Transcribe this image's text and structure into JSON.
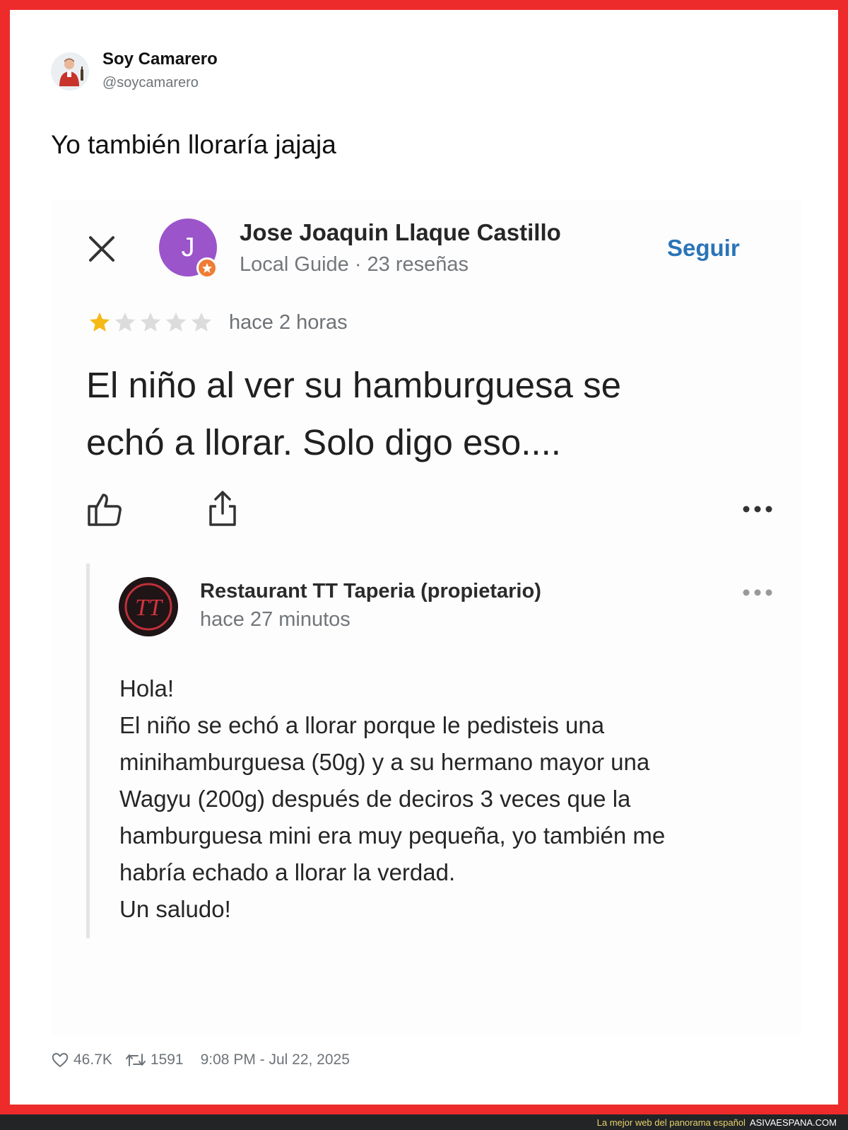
{
  "tweet": {
    "author_name": "Soy Camarero",
    "author_handle": "@soycamarero",
    "text": "Yo también lloraría jajaja",
    "likes": "46.7K",
    "retweets": "1591",
    "timestamp": "9:08 PM - Jul 22, 2025"
  },
  "review": {
    "avatar_letter": "J",
    "reviewer_name": "Jose Joaquin Llaque Castillo",
    "reviewer_meta": "Local Guide · 23 reseñas",
    "follow_label": "Seguir",
    "rating": 1,
    "rating_max": 5,
    "time": "hace 2 horas",
    "text_lines": [
      "El niño al ver su hamburguesa se",
      "echó a llorar. Solo digo eso...."
    ]
  },
  "reply": {
    "logo_text": "TT",
    "owner_name": "Restaurant TT Taperia (propietario)",
    "time": "hace 27 minutos",
    "lines": [
      "Hola!",
      "El niño se echó a llorar porque le pedisteis una",
      "minihamburguesa (50g) y a su hermano mayor una",
      "Wagyu (200g) después de deciros 3 veces que la",
      "hamburguesa mini era muy pequeña, yo también me",
      "habría echado a llorar la verdad.",
      "Un saludo!"
    ]
  },
  "footer": {
    "tagline": "La mejor web del panorama español",
    "site": "ASIVAESPANA.COM"
  },
  "colors": {
    "frame": "#ee2b2b",
    "follow": "#2a74b8",
    "reviewer_avatar": "#9b54c9",
    "star_filled": "#f5b916",
    "star_empty": "#dcdcdc"
  }
}
